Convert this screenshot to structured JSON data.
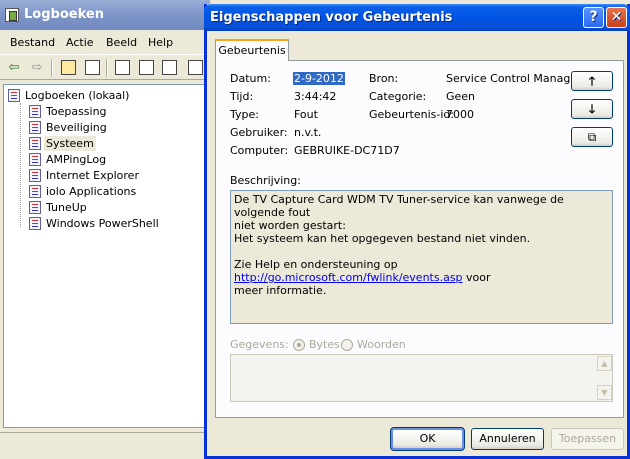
{
  "back_window": {
    "title": "Logboeken",
    "menu": [
      "Bestand",
      "Actie",
      "Beeld",
      "Help"
    ],
    "tree": {
      "root": "Logboeken (lokaal)",
      "items": [
        "Toepassing",
        "Beveiliging",
        "Systeem",
        "AMPingLog",
        "Internet Explorer",
        "iolo Applications",
        "TuneUp",
        "Windows PowerShell"
      ],
      "selected": "Systeem"
    }
  },
  "dialog": {
    "title": "Eigenschappen voor Gebeurtenis",
    "help_glyph": "?",
    "close_glyph": "✕",
    "tab": "Gebeurtenis",
    "fields": {
      "datum_label": "Datum:",
      "datum_value": "2-9-2012",
      "tijd_label": "Tijd:",
      "tijd_value": "3:44:42",
      "type_label": "Type:",
      "type_value": "Fout",
      "gebruiker_label": "Gebruiker:",
      "gebruiker_value": "n.v.t.",
      "computer_label": "Computer:",
      "computer_value": "GEBRUIKE-DC71D7",
      "bron_label": "Bron:",
      "bron_value": "Service Control Manager",
      "categorie_label": "Categorie:",
      "categorie_value": "Geen",
      "id_label": "Gebeurtenis-id:",
      "id_value": "7000"
    },
    "nav": {
      "up": "🡑",
      "down": "🡓",
      "copy": "⧉"
    },
    "description_label": "Beschrijving:",
    "description": {
      "line1": "De TV Capture Card WDM TV Tuner-service kan vanwege de volgende fout",
      "line2": "niet worden gestart:",
      "line3": "Het systeem kan het opgegeven bestand niet vinden.",
      "help_prefix": "Zie Help en ondersteuning op ",
      "help_link": "http://go.microsoft.com/fwlink/events.asp",
      "help_suffix": " voor",
      "help_line2": "meer informatie."
    },
    "data_section": {
      "label": "Gegevens:",
      "option_bytes": "Bytes",
      "option_words": "Woorden",
      "selected": "Bytes"
    },
    "buttons": {
      "ok": "OK",
      "cancel": "Annuleren",
      "apply": "Toepassen"
    }
  },
  "colors": {
    "accent": "#0054e3",
    "selection": "#316ac5",
    "link": "#0000ee"
  }
}
